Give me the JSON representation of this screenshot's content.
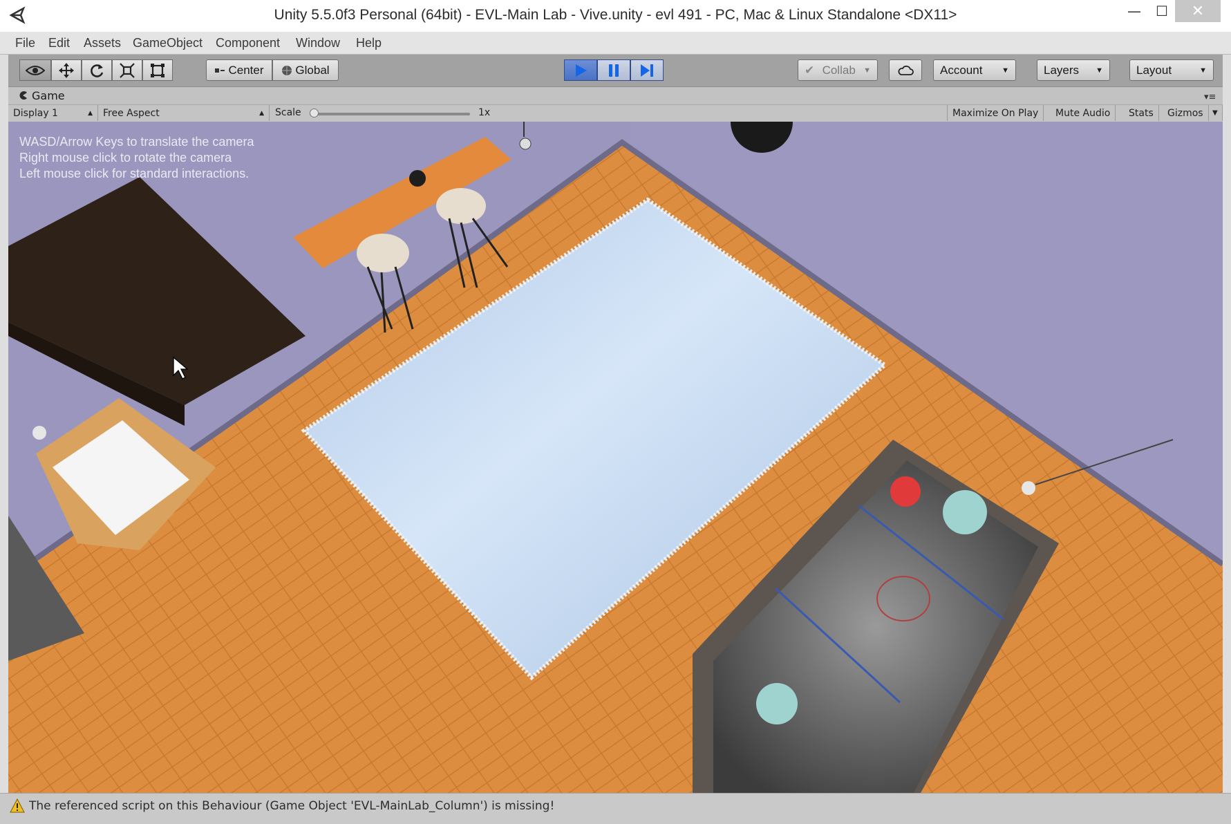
{
  "window": {
    "title": "Unity 5.5.0f3 Personal (64bit) - EVL-Main Lab - Vive.unity - evl 491 - PC, Mac & Linux Standalone <DX11>",
    "minimize": "—",
    "maximize": "☐",
    "close": "✕"
  },
  "menu": [
    "File",
    "Edit",
    "Assets",
    "GameObject",
    "Component",
    "Window",
    "Help"
  ],
  "toolbar": {
    "pivot": "Center",
    "space": "Global",
    "collab": "Collab",
    "account": "Account",
    "layers": "Layers",
    "layout": "Layout",
    "dropdown_arrow": "▼"
  },
  "game": {
    "tab": "Game",
    "display": "Display 1",
    "aspect": "Free Aspect",
    "scale_label": "Scale",
    "scale_value": "1x",
    "scale_fraction": 0.0,
    "maximize": "Maximize On Play",
    "mute": "Mute Audio",
    "stats": "Stats",
    "gizmos": "Gizmos",
    "hints": [
      "WASD/Arrow Keys to translate the camera",
      "Right mouse click to rotate the camera",
      "Left mouse click for standard interactions."
    ]
  },
  "status": {
    "message": "The referenced script on this Behaviour (Game Object 'EVL-MainLab_Column') is missing!"
  },
  "colors": {
    "toolbar": "#a2a2a2",
    "play_active": "#4a72c4",
    "wall": "#9591b7",
    "floor": "#d88a3a",
    "rug": "#bcd3ee",
    "warning": "#f0c020"
  }
}
